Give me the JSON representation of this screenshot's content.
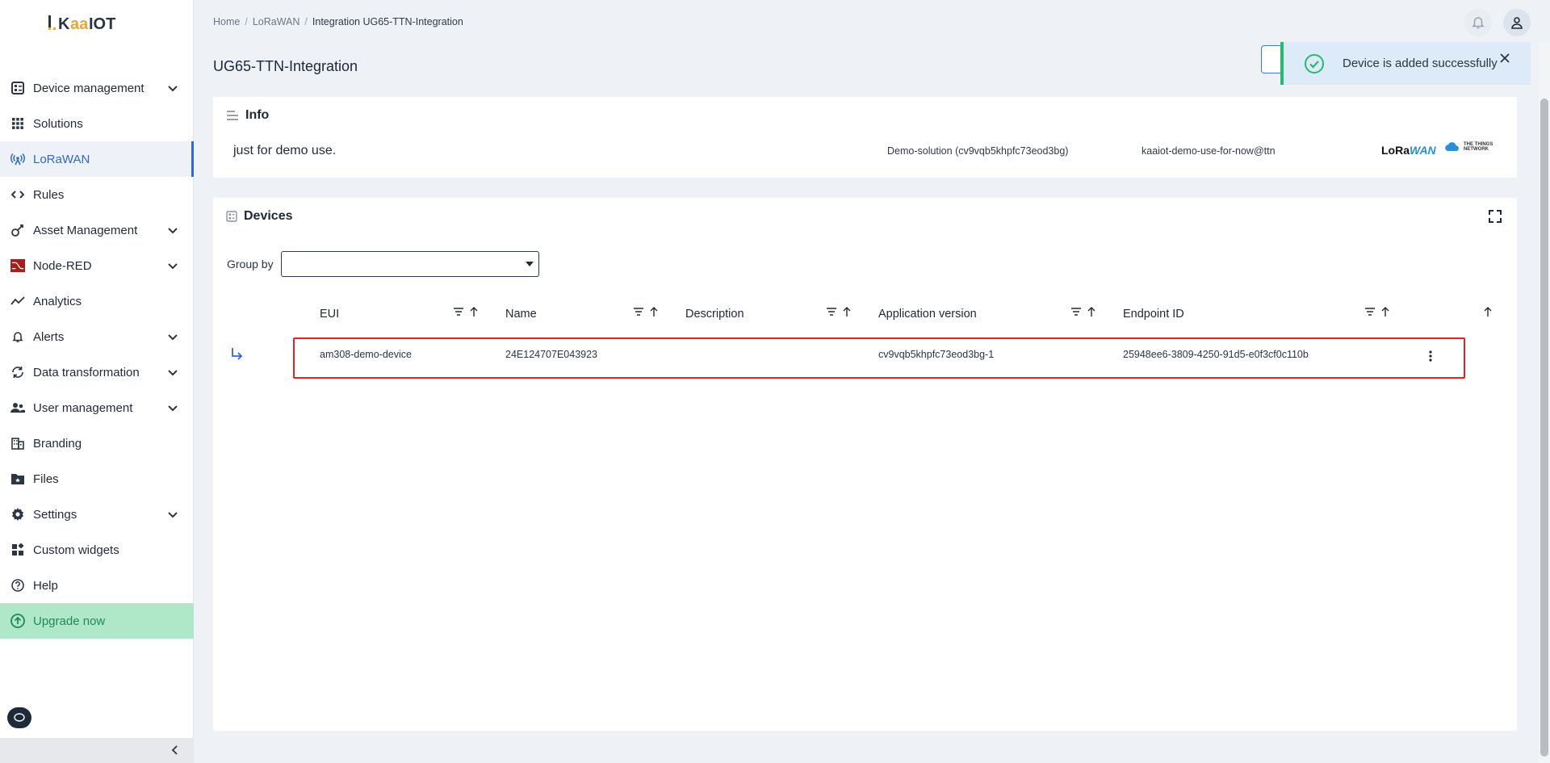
{
  "brand": {
    "logo_text": "KAAIOT"
  },
  "sidebar": {
    "items": [
      {
        "label": "Device management",
        "icon": "device-management-icon",
        "has_submenu": true
      },
      {
        "label": "Solutions",
        "icon": "grid-icon",
        "has_submenu": false
      },
      {
        "label": "LoRaWAN",
        "icon": "antenna-icon",
        "has_submenu": false,
        "active": true
      },
      {
        "label": "Rules",
        "icon": "code-icon",
        "has_submenu": false
      },
      {
        "label": "Asset Management",
        "icon": "asset-icon",
        "has_submenu": true
      },
      {
        "label": "Node-RED",
        "icon": "node-red-icon",
        "has_submenu": true
      },
      {
        "label": "Analytics",
        "icon": "analytics-icon",
        "has_submenu": false
      },
      {
        "label": "Alerts",
        "icon": "bell-icon",
        "has_submenu": true
      },
      {
        "label": "Data transformation",
        "icon": "transform-icon",
        "has_submenu": true
      },
      {
        "label": "User management",
        "icon": "users-icon",
        "has_submenu": true
      },
      {
        "label": "Branding",
        "icon": "building-icon",
        "has_submenu": false
      },
      {
        "label": "Files",
        "icon": "folder-icon",
        "has_submenu": false
      },
      {
        "label": "Settings",
        "icon": "gear-icon",
        "has_submenu": true
      },
      {
        "label": "Custom widgets",
        "icon": "widgets-icon",
        "has_submenu": false
      },
      {
        "label": "Help",
        "icon": "help-icon",
        "has_submenu": false
      }
    ],
    "upgrade_label": "Upgrade now"
  },
  "breadcrumb": {
    "home": "Home",
    "section": "LoRaWAN",
    "current": "Integration UG65-TTN-Integration",
    "separator": "/"
  },
  "page": {
    "title": "UG65-TTN-Integration"
  },
  "toast": {
    "message": "Device is added successfully"
  },
  "info": {
    "title": "Info",
    "description": "just for demo use.",
    "solution": "Demo-solution (cv9vqb5khpfc73eod3bg)",
    "account": "kaaiot-demo-use-for-now@ttn",
    "lora_logo_a": "LoRa",
    "lora_logo_b": "WAN",
    "ttn_logo_line1": "THE THINGS",
    "ttn_logo_line2": "NETWORK"
  },
  "devices": {
    "title": "Devices",
    "group_by_label": "Group by",
    "group_by_value": "",
    "columns": [
      "EUI",
      "Name",
      "Description",
      "Application version",
      "Endpoint ID"
    ],
    "rows": [
      {
        "eui": "am308-demo-device",
        "name": "24E124707E043923",
        "description": "",
        "application_version": "cv9vqb5khpfc73eod3bg-1",
        "endpoint_id": "25948ee6-3809-4250-91d5-e0f3cf0c110b"
      }
    ]
  },
  "colors": {
    "accent": "#2d6ad8",
    "success": "#2bb673",
    "highlight_border": "#e02424",
    "upgrade_bg": "#afe8c9"
  }
}
